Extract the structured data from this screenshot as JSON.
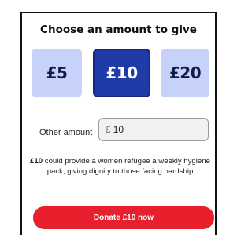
{
  "heading": "Choose an amount to give",
  "amounts": [
    {
      "label": "£5",
      "selected": false
    },
    {
      "label": "£10",
      "selected": true
    },
    {
      "label": "£20",
      "selected": false
    }
  ],
  "other_amount": {
    "label": "Other amount",
    "currency_symbol": "£",
    "value": "10"
  },
  "description": {
    "amount": "£10",
    "text": " could provide a women refugee a weekly hygiene pack, giving dignity to those facing hardship"
  },
  "donate_button": "Donate £10 now",
  "colors": {
    "unselected_amount": "#c7d2fb",
    "selected_amount": "#1e3ba8",
    "donate": "#e8202d"
  }
}
